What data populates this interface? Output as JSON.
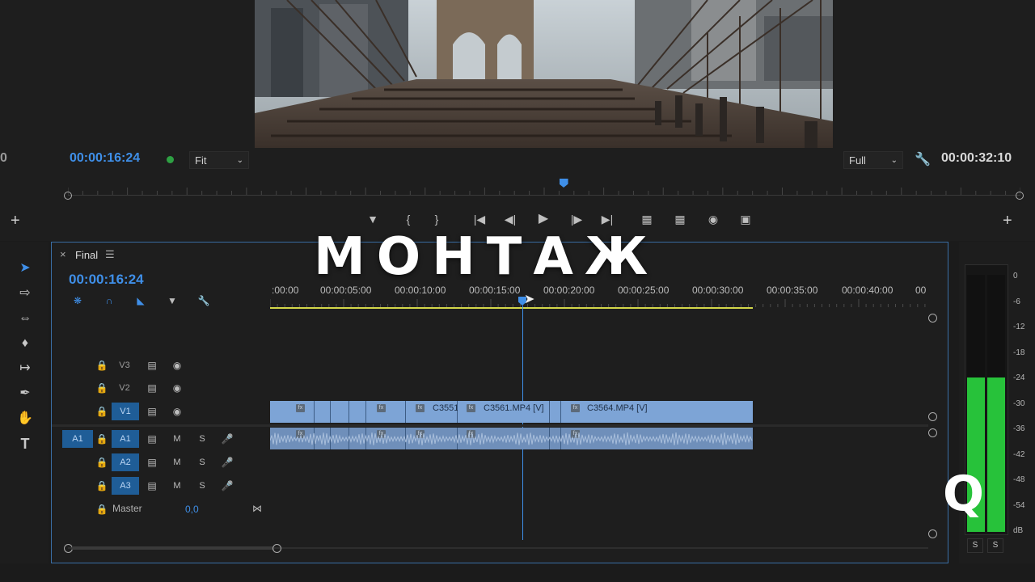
{
  "overlay": {
    "title": "МОНТАЖ",
    "logo_letter": "Q"
  },
  "program_monitor": {
    "left_edge_digit": "0",
    "current_timecode": "00:00:16:24",
    "zoom_select": "Fit",
    "resolution_select": "Full",
    "duration_timecode": "00:00:32:10",
    "add_left": "+",
    "add_right": "+",
    "controls": [
      "marker-icon",
      "mark-in-icon",
      "mark-out-icon",
      "go-to-in-icon",
      "step-back-icon",
      "play-icon",
      "step-forward-icon",
      "go-to-out-icon",
      "lift-icon",
      "extract-icon",
      "camera-icon",
      "compare-icon"
    ],
    "playhead_fraction": 0.52,
    "colors": {
      "timecode": "#3f8fe8",
      "status_dot": "#2ea043"
    }
  },
  "sequence": {
    "tab_label": "Final",
    "close": "×",
    "menu": "☰",
    "timecode": "00:00:16:24",
    "ruler_labels": [
      ":00:00",
      "00:00:05:00",
      "00:00:10:00",
      "00:00:15:00",
      "00:00:20:00",
      "00:00:25:00",
      "00:00:30:00",
      "00:00:35:00",
      "00:00:40:00",
      "00"
    ],
    "video_tracks": [
      {
        "name": "V3",
        "target": ""
      },
      {
        "name": "V2",
        "target": ""
      },
      {
        "name": "V1",
        "target": "V1"
      }
    ],
    "audio_tracks": [
      {
        "name": "A1",
        "source": "A1",
        "m": "M",
        "s": "S"
      },
      {
        "name": "A2",
        "source": "",
        "m": "M",
        "s": "S"
      },
      {
        "name": "A3",
        "source": "",
        "m": "M",
        "s": "S"
      }
    ],
    "master": {
      "label": "Master",
      "value": "0,0"
    },
    "clips": [
      {
        "label": "C3551"
      },
      {
        "label": "C3561.MP4 [V]"
      },
      {
        "label": "C3564.MP4 [V]"
      }
    ],
    "fx_badge": "fx",
    "colors": {
      "clip": "#7da4d6",
      "work_area": "#d3d74a",
      "playhead": "#3f8fe8"
    }
  },
  "tools": [
    "selection-icon",
    "track-select-icon",
    "ripple-edit-icon",
    "razor-icon",
    "slip-icon",
    "pen-icon",
    "hand-icon",
    "type-icon"
  ],
  "audio_meter": {
    "scale": [
      "0",
      "-6",
      "-12",
      "-18",
      "-24",
      "-30",
      "-36",
      "-42",
      "-48",
      "-54",
      "dB"
    ],
    "level_db": -24,
    "solo_left": "S",
    "solo_right": "S",
    "colors": {
      "level": "#27c23a"
    }
  }
}
